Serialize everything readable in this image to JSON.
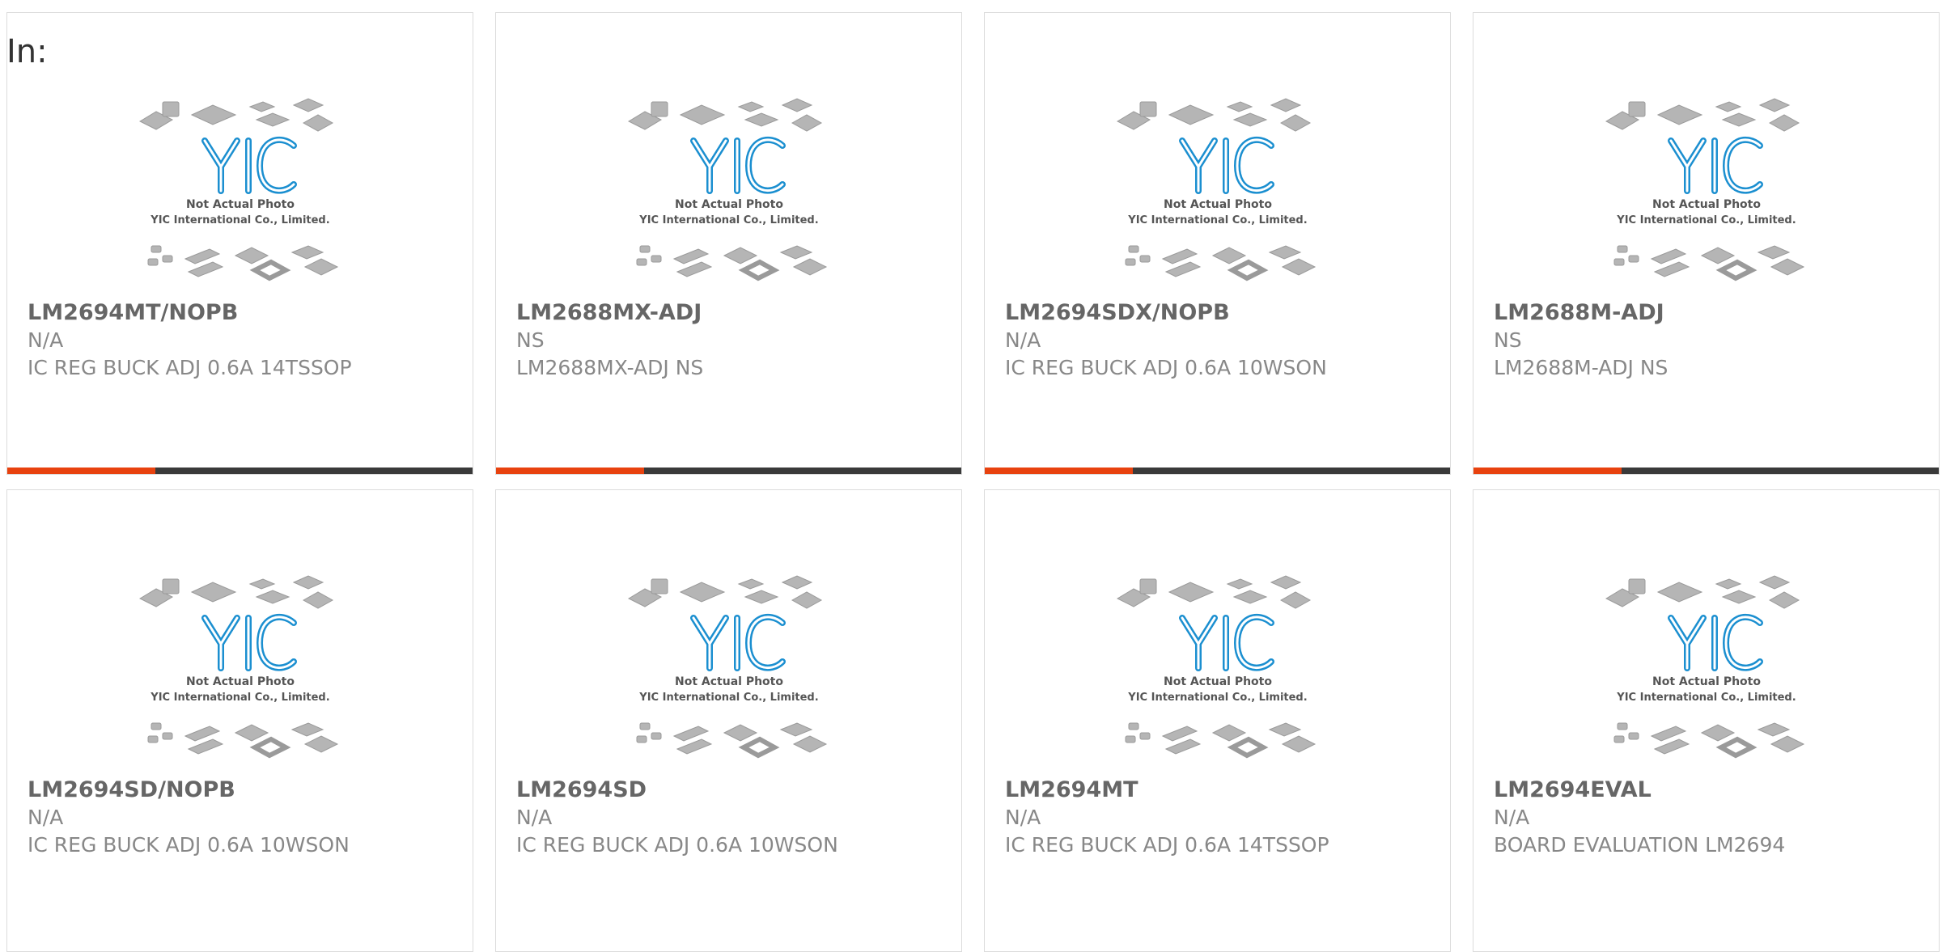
{
  "filter_label": "In:",
  "placeholder": {
    "brand": "YIC",
    "line1": "Not Actual Photo",
    "line2": "YIC International Co., Limited."
  },
  "colors": {
    "accent": "#e8420f",
    "bar": "#3a3a3a",
    "brand_blue": "#1b8fd0"
  },
  "products": [
    {
      "part": "LM2694MT/NOPB",
      "mfr": "N/A",
      "desc": "IC REG BUCK ADJ 0.6A 14TSSOP"
    },
    {
      "part": "LM2688MX-ADJ",
      "mfr": "NS",
      "desc": "LM2688MX-ADJ NS"
    },
    {
      "part": "LM2694SDX/NOPB",
      "mfr": "N/A",
      "desc": "IC REG BUCK ADJ 0.6A 10WSON"
    },
    {
      "part": "LM2688M-ADJ",
      "mfr": "NS",
      "desc": "LM2688M-ADJ NS"
    },
    {
      "part": "LM2694SD/NOPB",
      "mfr": "N/A",
      "desc": "IC REG BUCK ADJ 0.6A 10WSON"
    },
    {
      "part": "LM2694SD",
      "mfr": "N/A",
      "desc": "IC REG BUCK ADJ 0.6A 10WSON"
    },
    {
      "part": "LM2694MT",
      "mfr": "N/A",
      "desc": "IC REG BUCK ADJ 0.6A 14TSSOP"
    },
    {
      "part": "LM2694EVAL",
      "mfr": "N/A",
      "desc": "BOARD EVALUATION LM2694"
    }
  ]
}
